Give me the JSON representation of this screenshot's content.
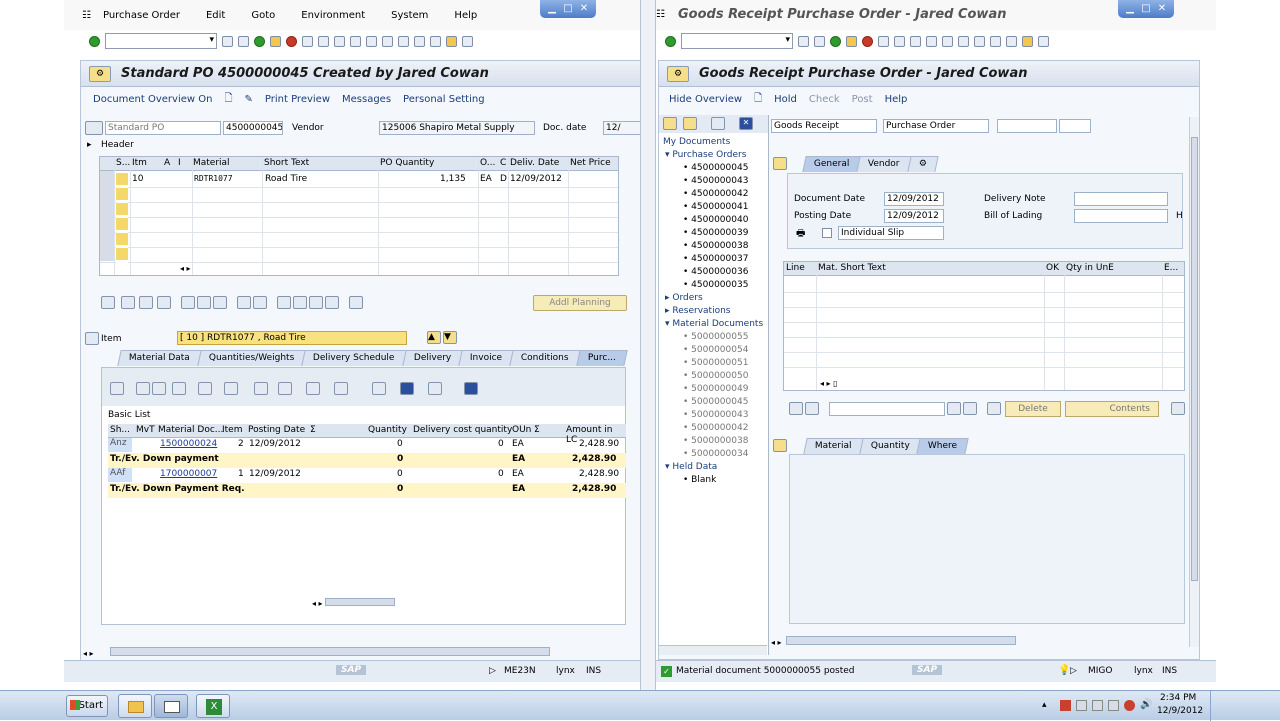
{
  "left": {
    "menu": [
      "Purchase Order",
      "Edit",
      "Goto",
      "Environment",
      "System",
      "Help"
    ],
    "title": "Standard PO 4500000045 Created by Jared Cowan",
    "app_toolbar": {
      "doc_overview": "Document Overview On",
      "print_preview": "Print Preview",
      "messages": "Messages",
      "personal_setting": "Personal Setting"
    },
    "header_fields": {
      "po_type": "Standard PO",
      "po_number": "4500000045",
      "vendor_label": "Vendor",
      "vendor": "125006 Shapiro Metal Supply",
      "docdate_label": "Doc. date",
      "docdate": "12/"
    },
    "header_label": "Header",
    "items_columns": [
      "S...",
      "Itm",
      "A",
      "I",
      "Material",
      "Short Text",
      "PO Quantity",
      "O...",
      "C",
      "Deliv. Date",
      "Net Price"
    ],
    "items_rows": [
      {
        "itm": "10",
        "material": "RDTR1077",
        "short_text": "Road Tire",
        "po_qty": "1,135",
        "uom": "EA",
        "c": "D",
        "deliv": "12/09/2012",
        "price": ""
      }
    ],
    "addl_planning": "Addl Planning",
    "item_label": "Item",
    "item_select": "[ 10 ] RDTR1077 , Road Tire",
    "item_tabs": [
      "Material Data",
      "Quantities/Weights",
      "Delivery Schedule",
      "Delivery",
      "Invoice",
      "Conditions",
      "Purc..."
    ],
    "basic_list_label": "Basic List",
    "history_columns": [
      "Sh...",
      "MvT",
      "Material Doc...",
      "Item",
      "Posting Date",
      "Σ",
      "Quantity",
      "Delivery cost quantity",
      "OUn",
      "Σ",
      "Amount in LC"
    ],
    "history_rows": [
      {
        "type": "normal",
        "sh": "Anz",
        "mvt": "",
        "doc": "1500000024",
        "item": "2",
        "date": "12/09/2012",
        "qty": "0",
        "dcq": "0",
        "oun": "EA",
        "amount": "2,428.90"
      },
      {
        "type": "total",
        "sh": "Tr./Ev. Down payment",
        "qty": "0",
        "oun": "EA",
        "amount": "2,428.90"
      },
      {
        "type": "normal",
        "sh": "AAf",
        "mvt": "",
        "doc": "1700000007",
        "item": "1",
        "date": "12/09/2012",
        "qty": "0",
        "dcq": "0",
        "oun": "EA",
        "amount": "2,428.90"
      },
      {
        "type": "total",
        "sh": "Tr./Ev. Down Payment Req.",
        "qty": "0",
        "oun": "EA",
        "amount": "2,428.90"
      }
    ],
    "status": {
      "sap": "SAP",
      "tcode": "ME23N",
      "server": "lynx",
      "mode": "INS"
    }
  },
  "right": {
    "window_title": "Goods Receipt Purchase Order - Jared Cowan",
    "title": "Goods Receipt Purchase Order - Jared Cowan",
    "app_toolbar": {
      "hide_overview": "Hide Overview",
      "hold": "Hold",
      "check": "Check",
      "post": "Post",
      "help": "Help"
    },
    "tree": {
      "my_documents": "My Documents",
      "purchase_orders": "Purchase Orders",
      "po_list": [
        "4500000045",
        "4500000043",
        "4500000042",
        "4500000041",
        "4500000040",
        "4500000039",
        "4500000038",
        "4500000037",
        "4500000036",
        "4500000035"
      ],
      "orders": "Orders",
      "reservations": "Reservations",
      "material_documents": "Material Documents",
      "md_list": [
        "5000000055",
        "5000000054",
        "5000000051",
        "5000000050",
        "5000000049",
        "5000000045",
        "5000000043",
        "5000000042",
        "5000000038",
        "5000000034"
      ],
      "held_data": "Held Data",
      "blank": "Blank"
    },
    "action_select": "Goods Receipt",
    "ref_select": "Purchase Order",
    "header_tabs": [
      "General",
      "Vendor"
    ],
    "doc_date_label": "Document Date",
    "doc_date": "12/09/2012",
    "post_date_label": "Posting Date",
    "post_date": "12/09/2012",
    "delivery_note_label": "Delivery Note",
    "bill_label": "Bill of Lading",
    "slip_select": "Individual Slip",
    "h_label": "H",
    "line_columns": [
      "Line",
      "Mat. Short Text",
      "OK",
      "Qty in UnE",
      "E..."
    ],
    "delete_btn": "Delete",
    "contents_btn": "Contents",
    "detail_tabs": [
      "Material",
      "Quantity",
      "Where"
    ],
    "status": {
      "message": "Material document 5000000055 posted",
      "sap": "SAP",
      "tcode": "MIGO",
      "server": "lynx",
      "mode": "INS"
    }
  },
  "taskbar": {
    "start": "Start",
    "time": "2:34 PM",
    "date": "12/9/2012"
  }
}
